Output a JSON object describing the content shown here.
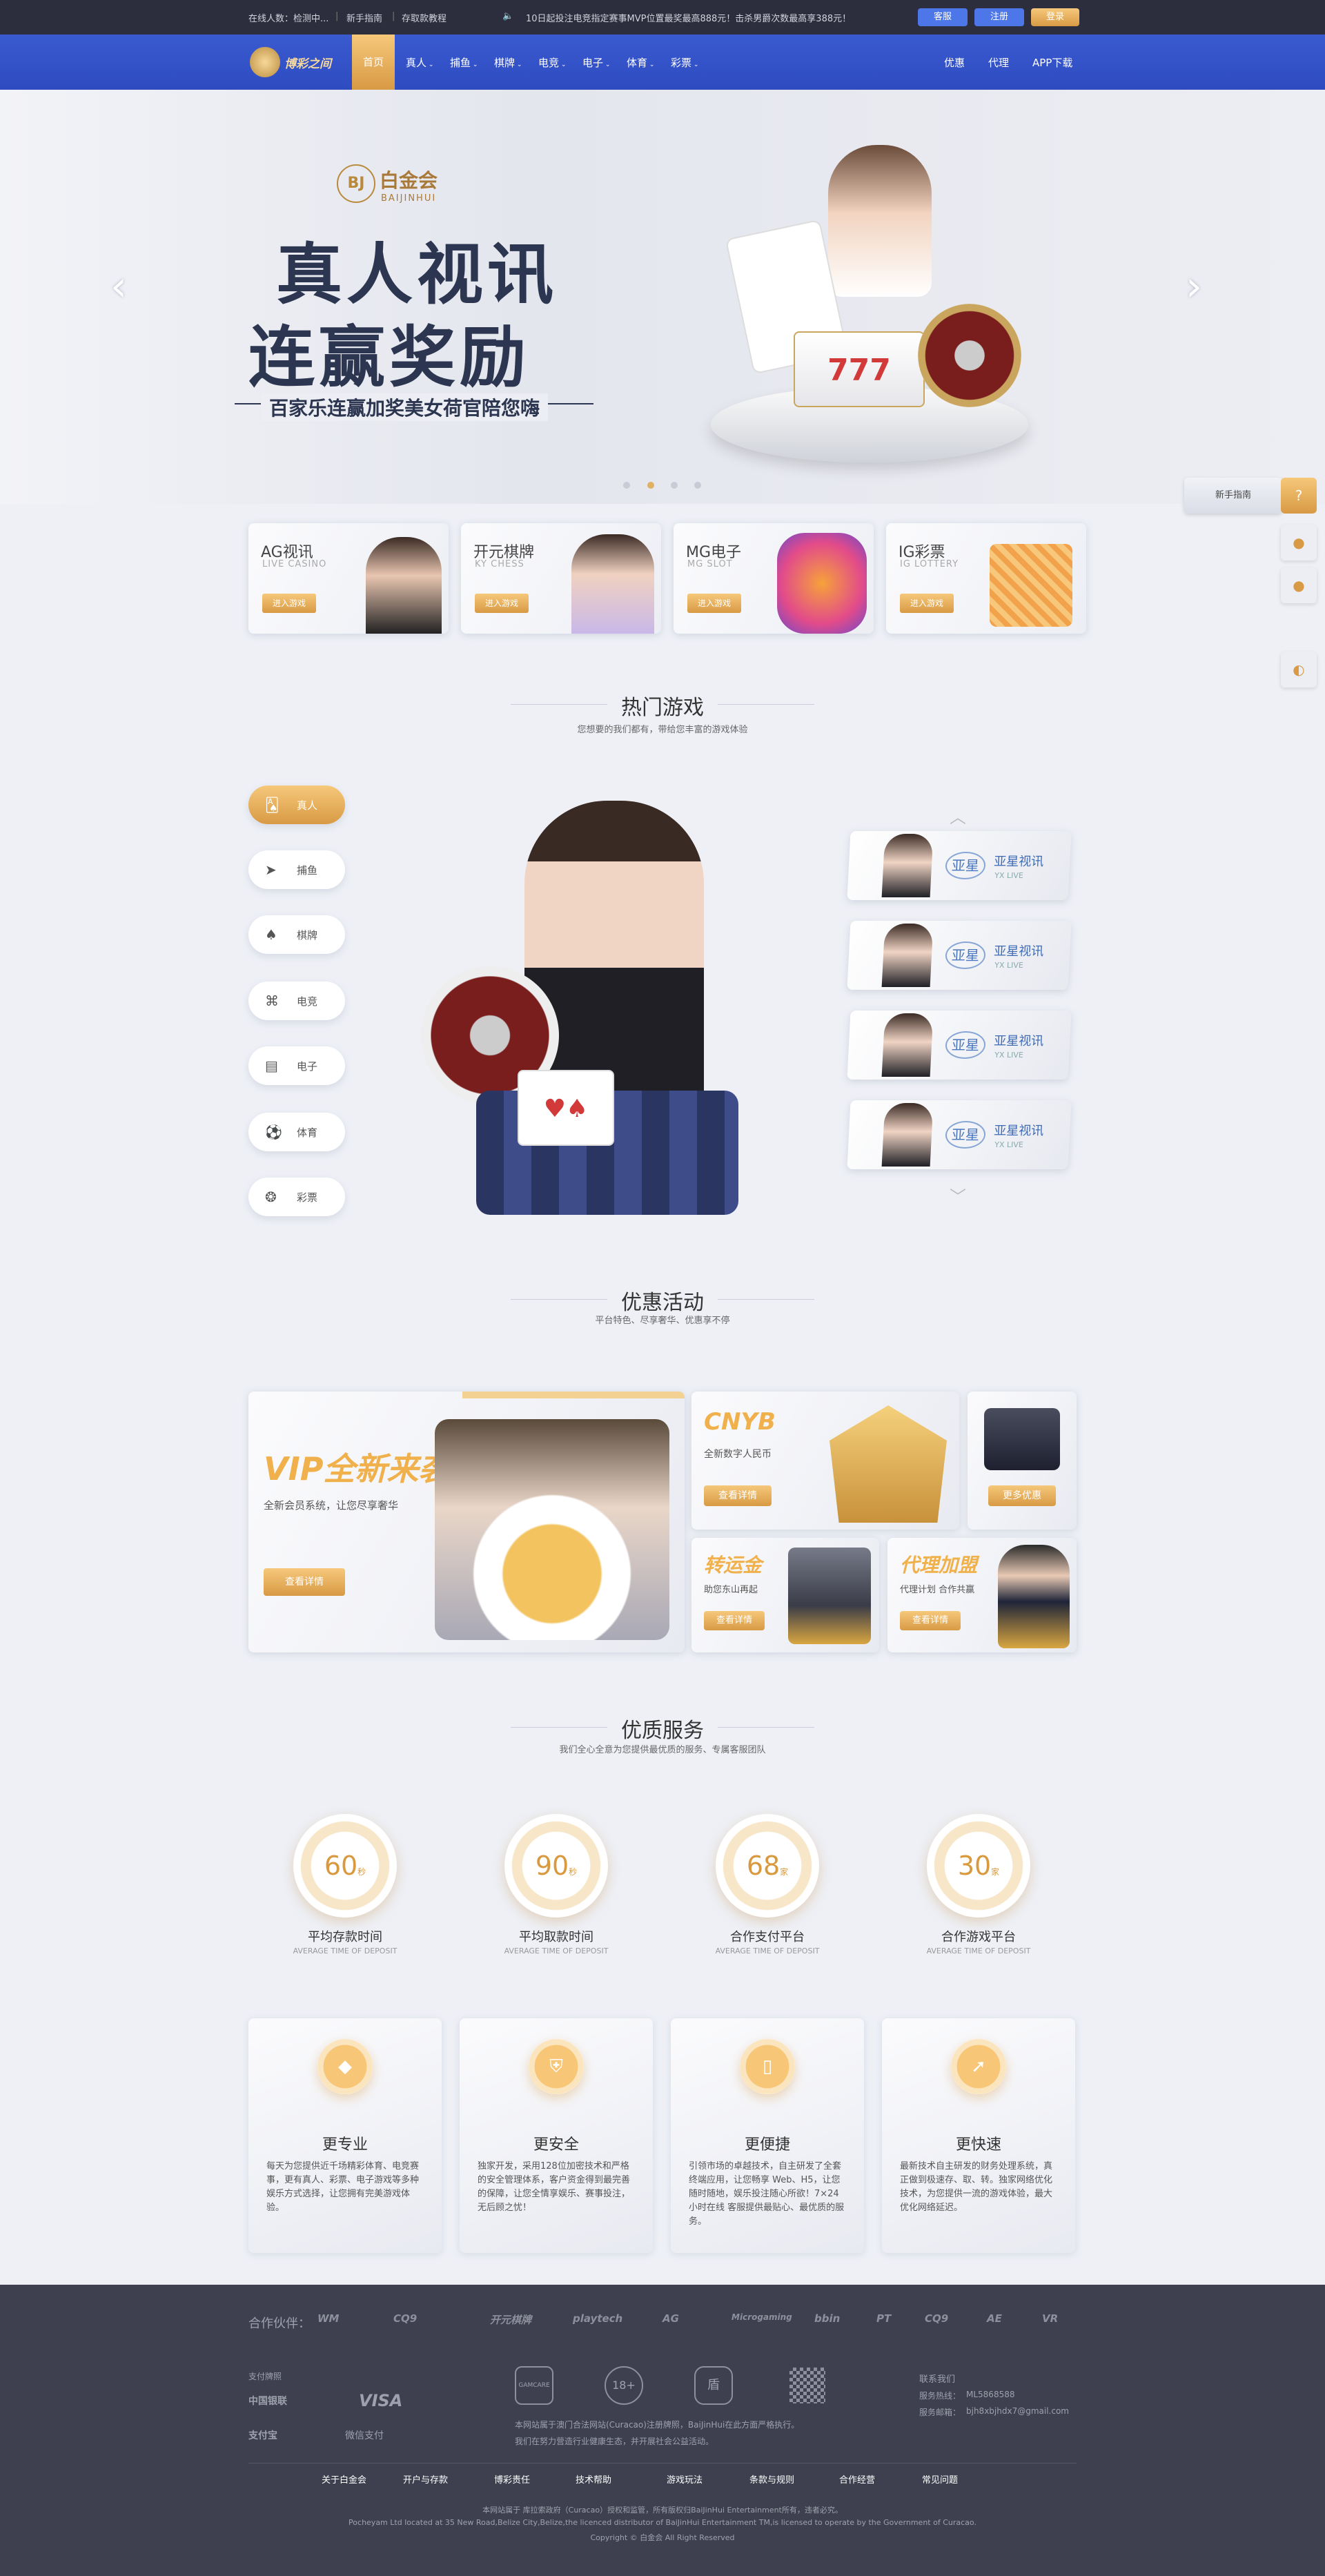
{
  "topbar": {
    "online": "在线人数：检测中...",
    "guide": "新手指南",
    "tutorial": "存取款教程",
    "marquee": "10日起投注电竞指定赛事MVP位置最奖最高888元！击杀男爵次数最高享388元！",
    "btn_service": "客服",
    "btn_register": "注册",
    "btn_login": "登录"
  },
  "nav": {
    "logo": "博彩之间",
    "items": [
      "首页",
      "真人",
      "捕鱼",
      "棋牌",
      "电竞",
      "电子",
      "体育",
      "彩票"
    ],
    "right": [
      "优惠",
      "代理",
      "APP下载"
    ]
  },
  "hero": {
    "brand_badge": "BJ",
    "brand_cn": "白金会",
    "brand_en": "BAIJINHUI",
    "headline1": "真人视讯",
    "headline2": "连赢奖励",
    "subline": "百家乐连赢加奖美女荷官陪您嗨",
    "prev_arrow": "‹",
    "next_arrow": "›"
  },
  "float_menu": {
    "guide": "新手指南"
  },
  "game_cards": [
    {
      "title": "AG视讯",
      "sub": "LIVE CASINO",
      "btn": "进入游戏"
    },
    {
      "title": "开元棋牌",
      "sub": "KY CHESS",
      "btn": "进入游戏"
    },
    {
      "title": "MG电子",
      "sub": "MG SLOT",
      "btn": "进入游戏"
    },
    {
      "title": "IG彩票",
      "sub": "IG LOTTERY",
      "btn": "进入游戏"
    }
  ],
  "hot_games": {
    "title": "热门游戏",
    "subtitle": "您想要的我们都有，带给您丰富的游戏体验",
    "categories": [
      "真人",
      "捕鱼",
      "棋牌",
      "电竞",
      "电子",
      "体育",
      "彩票"
    ],
    "providers": [
      {
        "name": "亚星视讯",
        "sub": "YX LIVE",
        "logo": "亚星"
      },
      {
        "name": "亚星视讯",
        "sub": "YX LIVE",
        "logo": "亚星"
      },
      {
        "name": "亚星视讯",
        "sub": "YX LIVE",
        "logo": "亚星"
      },
      {
        "name": "亚星视讯",
        "sub": "YX LIVE",
        "logo": "亚星"
      }
    ]
  },
  "promos": {
    "title": "优惠活动",
    "subtitle": "平台特色、尽享奢华、优惠享不停",
    "vip": {
      "title": "VIP全新来袭",
      "desc": "全新会员系统，让您尽享奢华",
      "btn": "查看详情"
    },
    "cny": {
      "title": "CNYB",
      "desc": "全新数字人民币",
      "btn": "查看详情"
    },
    "more": {
      "btn": "更多优惠"
    },
    "luck": {
      "title": "转运金",
      "desc": "助您东山再起",
      "btn": "查看详情"
    },
    "agent": {
      "title": "代理加盟",
      "desc": "代理计划 合作共赢",
      "btn": "查看详情"
    }
  },
  "service": {
    "title": "优质服务",
    "subtitle": "我们全心全意为您提供最优质的服务、专属客服团队",
    "stats": [
      {
        "value": "60",
        "unit": "秒",
        "label": "平均存款时间",
        "sub": "AVERAGE TIME OF DEPOSIT"
      },
      {
        "value": "90",
        "unit": "秒",
        "label": "平均取款时间",
        "sub": "AVERAGE TIME OF DEPOSIT"
      },
      {
        "value": "68",
        "unit": "家",
        "label": "合作支付平台",
        "sub": "AVERAGE TIME OF DEPOSIT"
      },
      {
        "value": "30",
        "unit": "家",
        "label": "合作游戏平台",
        "sub": "AVERAGE TIME OF DEPOSIT"
      }
    ],
    "features": [
      {
        "title": "更专业",
        "desc": "每天为您提供近千场精彩体育、电竞赛事，更有真人、彩票、电子游戏等多种娱乐方式选择，让您拥有完美游戏体验。"
      },
      {
        "title": "更安全",
        "desc": "独家开发，采用128位加密技术和严格的安全管理体系，客户资金得到最完善的保障，让您全情享娱乐、赛事投注，无后顾之忧！"
      },
      {
        "title": "更便捷",
        "desc": "引领市场的卓越技术，自主研发了全套终端应用，让您畅享 Web、H5，让您随时随地，娱乐投注随心所欲！7×24小时在线 客服提供最贴心、最优质的服务。"
      },
      {
        "title": "更快速",
        "desc": "最新技术自主研发的财务处理系统，真正做到极速存、取、转。独家网络优化技术，为您提供一流的游戏体验，最大优化网络延迟。"
      }
    ]
  },
  "footer": {
    "partners_label": "合作伙伴：",
    "partners": [
      "WM",
      "CQ9",
      "开元棋牌",
      "playtech",
      "AG",
      "Microgaming",
      "bbin",
      "PT",
      "CQ9",
      "AE",
      "VR"
    ],
    "pay_label": "支付牌照",
    "pay": [
      "中国银联",
      "VISA",
      "支付宝",
      "微信支付"
    ],
    "badges": [
      "GAMCARE",
      "18+",
      "盾"
    ],
    "notice1": "本网站属于澳门合法网站(Curacao)注册牌照，BaiJinHui在此方面严格执行。",
    "notice2": "我们在努力营造行业健康生态，并开展社会公益活动。",
    "contact_title": "联系我们",
    "contact_phone_label": "服务热线：",
    "contact_phone": "ML5868588",
    "contact_mail_label": "服务邮箱：",
    "contact_mail": "bjh8xbjhdx7@gmail.com",
    "links": [
      "关于白金会",
      "开户与存款",
      "博彩责任",
      "技术帮助",
      "游戏玩法",
      "条款与规则",
      "合作经营",
      "常见问题"
    ],
    "copy1": "本网站属于 库拉索政府（Curacao）授权和监管，所有版权归BaiJinHui Entertainment所有，违者必究。",
    "copy2": "Pocheyam Ltd located at 35 New Road,Belize City,Belize,the licenced distributor of BaiJinHui Entertainment TM,is licensed to operate by the Government of Curacao.",
    "copy3": "Copyright © 白金会 All Right Reserved"
  }
}
